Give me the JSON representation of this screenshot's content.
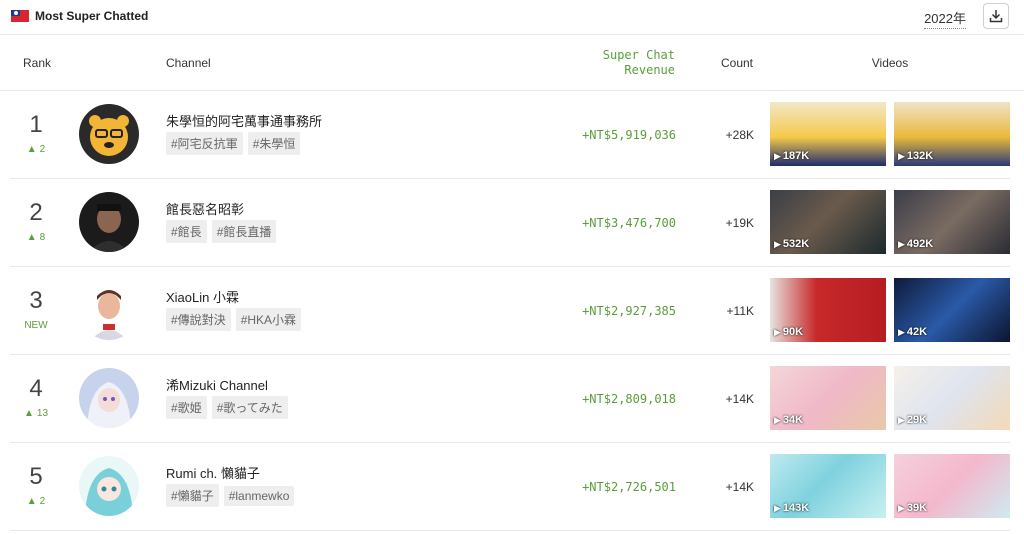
{
  "header": {
    "title": "Most Super Chatted",
    "year": "2022年",
    "flag_icon": "taiwan-flag-icon",
    "download_icon": "download-icon"
  },
  "columns": {
    "rank": "Rank",
    "channel": "Channel",
    "revenue_line1": "Super Chat",
    "revenue_line2": "Revenue",
    "count": "Count",
    "videos": "Videos"
  },
  "colors": {
    "positive": "#5a9e3a",
    "divider": "#e6e6e6",
    "tag_bg": "#eeeeee"
  },
  "rows": [
    {
      "rank": "1",
      "change": "2",
      "change_arrow": "^",
      "channel": "朱學恒的阿宅萬事通事務所",
      "tags": [
        "#阿宅反抗軍",
        "#朱學恒"
      ],
      "revenue": "+NT$5,919,036",
      "count": "+28K",
      "videos": [
        {
          "views": "187K"
        },
        {
          "views": "132K"
        }
      ]
    },
    {
      "rank": "2",
      "change": "8",
      "change_arrow": "^",
      "channel": "館長惡名昭彰",
      "tags": [
        "#館長",
        "#館長直播"
      ],
      "revenue": "+NT$3,476,700",
      "count": "+19K",
      "videos": [
        {
          "views": "532K"
        },
        {
          "views": "492K"
        }
      ]
    },
    {
      "rank": "3",
      "change": "NEW",
      "change_arrow": "",
      "channel": "XiaoLin 小霖",
      "tags": [
        "#傳說對決",
        "#HKA小霖"
      ],
      "revenue": "+NT$2,927,385",
      "count": "+11K",
      "videos": [
        {
          "views": "90K"
        },
        {
          "views": "42K"
        }
      ]
    },
    {
      "rank": "4",
      "change": "13",
      "change_arrow": "^",
      "channel": "浠Mizuki Channel",
      "tags": [
        "#歌姫",
        "#歌ってみた"
      ],
      "revenue": "+NT$2,809,018",
      "count": "+14K",
      "videos": [
        {
          "views": "34K"
        },
        {
          "views": "29K"
        }
      ]
    },
    {
      "rank": "5",
      "change": "2",
      "change_arrow": "^",
      "channel": "Rumi ch. 懶貓子",
      "tags": [
        "#懶貓子",
        "#lanmewko"
      ],
      "revenue": "+NT$2,726,501",
      "count": "+14K",
      "videos": [
        {
          "views": "143K"
        },
        {
          "views": "39K"
        }
      ]
    }
  ]
}
